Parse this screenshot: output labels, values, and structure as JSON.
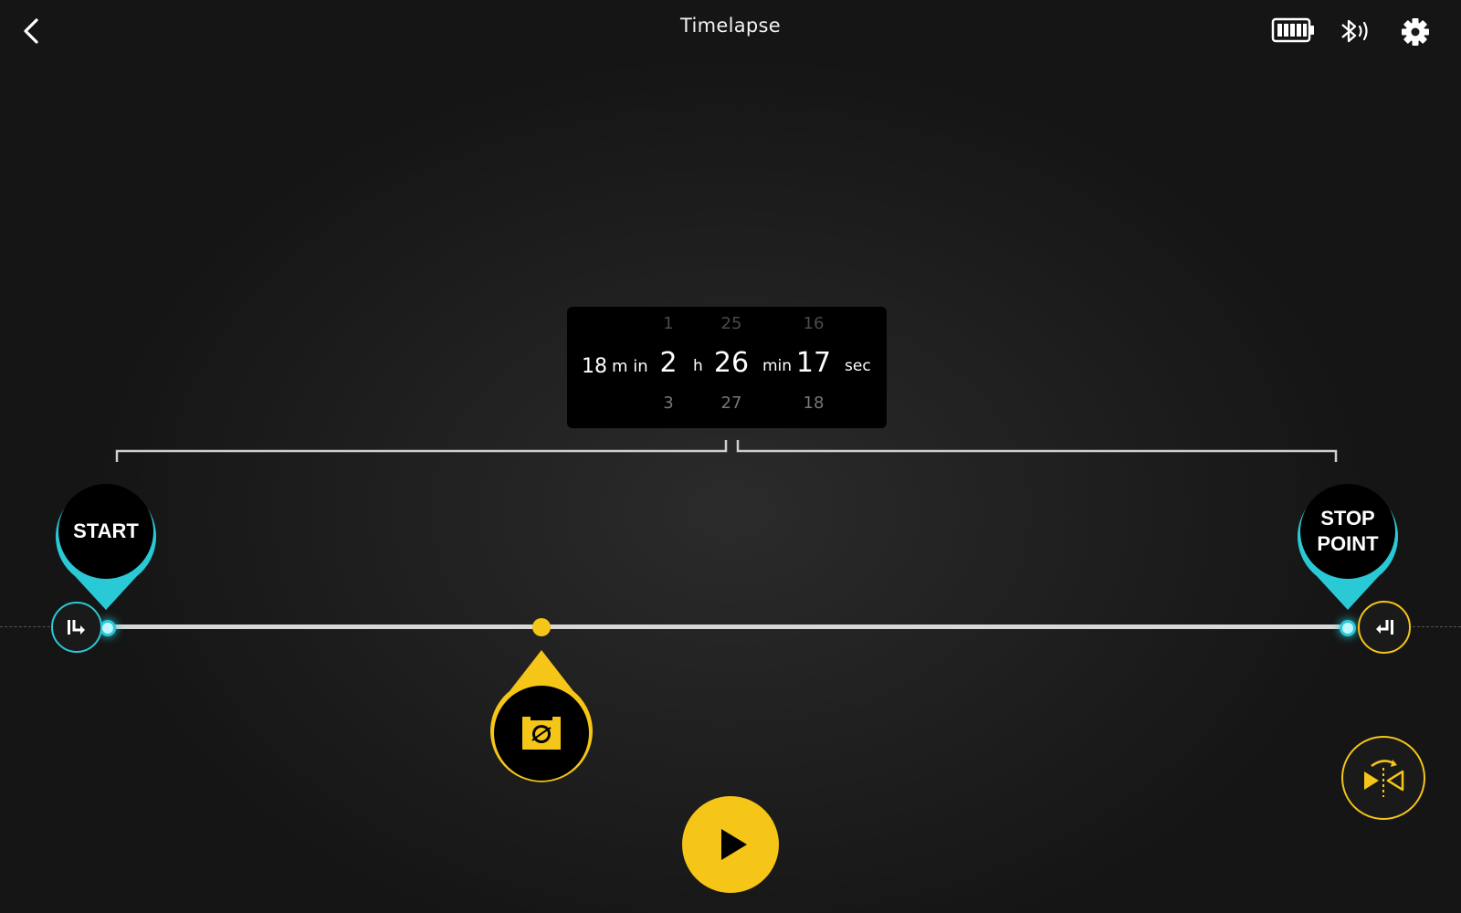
{
  "header": {
    "title": "Timelapse",
    "back_icon": "chevron-left-icon",
    "battery_icon": "battery-icon",
    "bluetooth_icon": "bluetooth-icon",
    "settings_icon": "gear-icon"
  },
  "duration_picker": {
    "prefix_value": "18",
    "prefix_unit": "m in",
    "hours": {
      "prev": "1",
      "value": "2",
      "next": "3",
      "unit": "h"
    },
    "minutes": {
      "prev": "25",
      "value": "26",
      "next": "27",
      "unit": "min"
    },
    "seconds": {
      "prev": "16",
      "value": "17",
      "next": "18",
      "unit": "sec"
    }
  },
  "timeline": {
    "start_label": "START",
    "stop_label_line1": "STOP",
    "stop_label_line2": "POINT",
    "keyframe_position": 0.35
  },
  "controls": {
    "play_icon": "play-icon",
    "mirror_icon": "mirror-rotate-icon",
    "camera_icon": "camera-icon",
    "go_start_icon": "go-to-start-icon",
    "go_end_icon": "go-to-end-icon"
  },
  "colors": {
    "accent_yellow": "#f5c518",
    "accent_cyan": "#29c9d6",
    "background": "#1f1f1f"
  }
}
